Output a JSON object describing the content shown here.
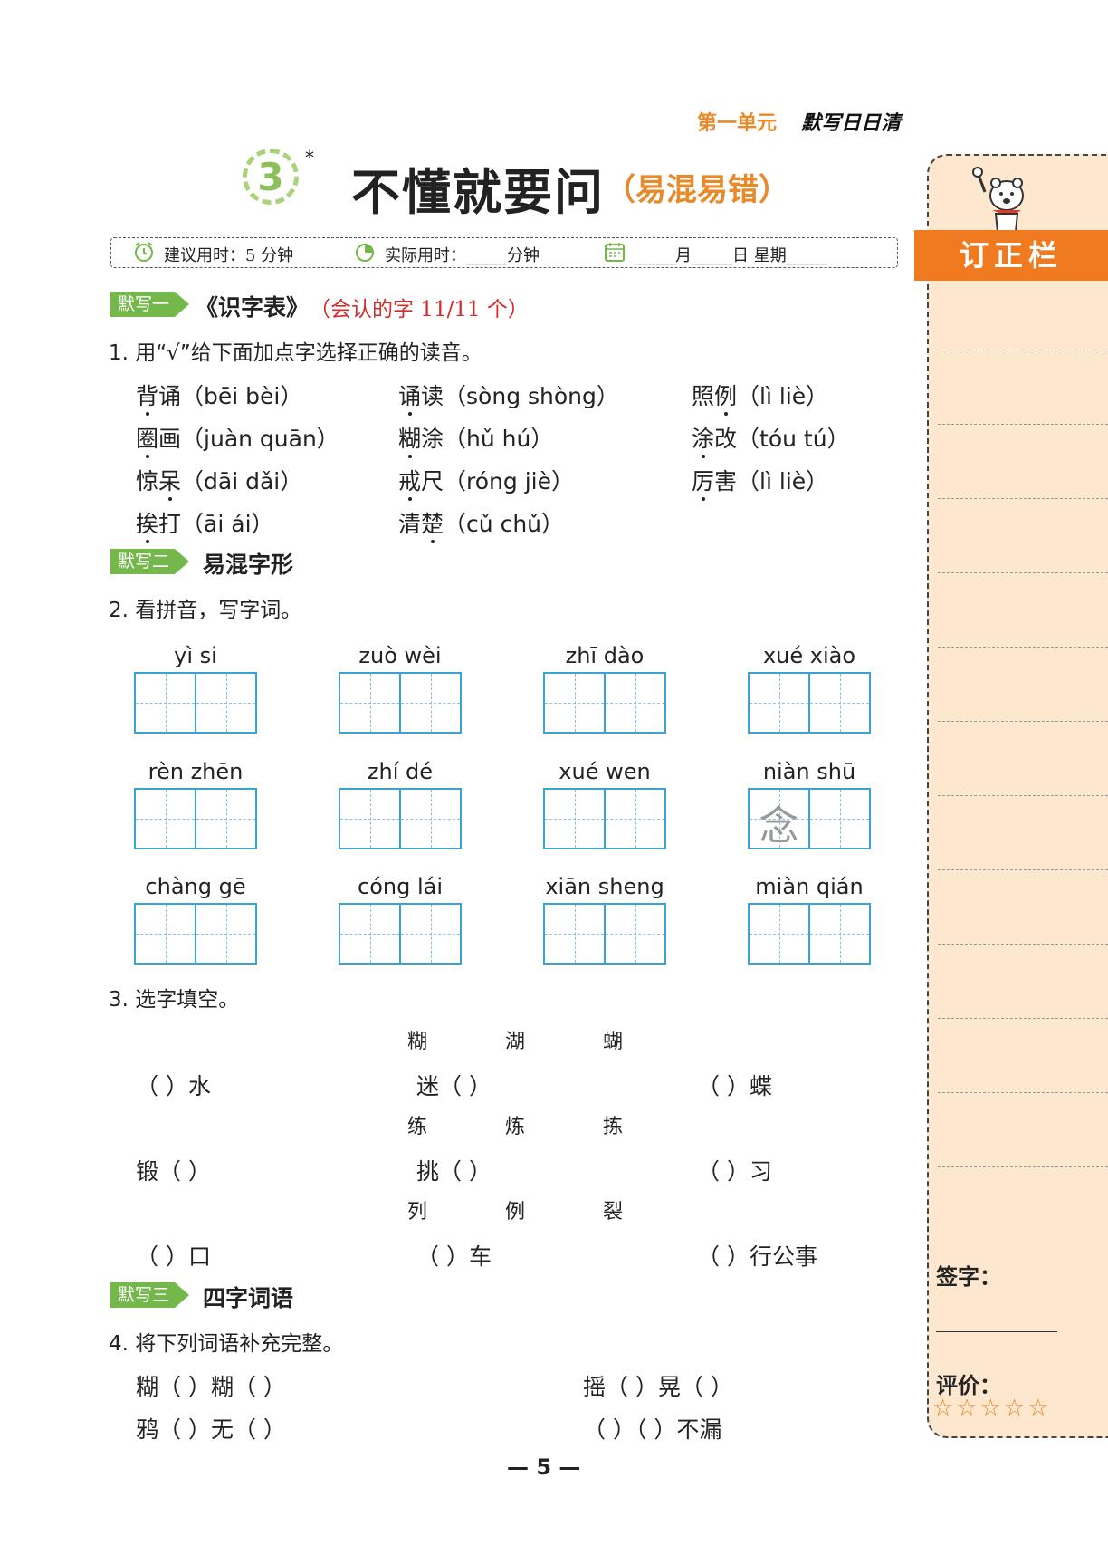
{
  "header": {
    "unit": "第一单元",
    "sub": "默写日日清"
  },
  "lesson": {
    "number": "3",
    "star": "*",
    "title": "不懂就要问",
    "subtitle": "（易混易错）"
  },
  "timebar": {
    "suggest": "建议用时：5 分钟",
    "actual": "实际用时：_____分钟",
    "date": "_____月_____日   星期_____"
  },
  "section1": {
    "tag": "默写一",
    "title": "《识字表》",
    "note": "（会认的字 11/11 个）"
  },
  "q1": {
    "title": "1. 用“√”给下面加点字选择正确的读音。",
    "items": [
      {
        "word": "背诵",
        "dot": 0,
        "pinyin": "（bēi    bèi）"
      },
      {
        "word": "诵读",
        "dot": 0,
        "pinyin": "（sòng    shòng）"
      },
      {
        "word": "照例",
        "dot": 1,
        "pinyin": "（lì    liè）"
      },
      {
        "word": "圈画",
        "dot": 0,
        "pinyin": "（juàn    quān）"
      },
      {
        "word": "糊涂",
        "dot": 0,
        "pinyin": "（hǔ    hú）"
      },
      {
        "word": "涂改",
        "dot": 0,
        "pinyin": "（tóu    tú）"
      },
      {
        "word": "惊呆",
        "dot": 1,
        "pinyin": "（dāi    dǎi）"
      },
      {
        "word": "戒尺",
        "dot": 0,
        "pinyin": "（róng    jiè）"
      },
      {
        "word": "厉害",
        "dot": 0,
        "pinyin": "（lì    liè）"
      },
      {
        "word": "挨打",
        "dot": 0,
        "pinyin": "（āi    ái）"
      },
      {
        "word": "清楚",
        "dot": 1,
        "pinyin": "（cǔ    chǔ）"
      }
    ]
  },
  "section2": {
    "tag": "默写二",
    "title": "易混字形"
  },
  "q2": {
    "title": "2. 看拼音，写字词。",
    "items": [
      {
        "pinyin": "yì    si",
        "hint": ""
      },
      {
        "pinyin": "zuò    wèi",
        "hint": ""
      },
      {
        "pinyin": "zhī    dào",
        "hint": ""
      },
      {
        "pinyin": "xué    xiào",
        "hint": ""
      },
      {
        "pinyin": "rèn    zhēn",
        "hint": ""
      },
      {
        "pinyin": "zhí    dé",
        "hint": ""
      },
      {
        "pinyin": "xué    wen",
        "hint": ""
      },
      {
        "pinyin": "niàn    shū",
        "hint": "念"
      },
      {
        "pinyin": "chàng  gē",
        "hint": ""
      },
      {
        "pinyin": "cóng    lái",
        "hint": ""
      },
      {
        "pinyin": "xiān sheng",
        "hint": ""
      },
      {
        "pinyin": "miàn  qián",
        "hint": ""
      }
    ]
  },
  "q3": {
    "title": "3. 选字填空。",
    "groups": [
      {
        "options": [
          "糊",
          "湖",
          "蝴"
        ],
        "blanks": [
          "（          ）水",
          "迷（          ）",
          "（          ）蝶"
        ]
      },
      {
        "options": [
          "练",
          "炼",
          "拣"
        ],
        "blanks": [
          "锻（          ）",
          "挑（          ）",
          "（          ）习"
        ]
      },
      {
        "options": [
          "列",
          "例",
          "裂"
        ],
        "blanks": [
          "（          ）口",
          "（          ）车",
          "（          ）行公事"
        ]
      }
    ]
  },
  "section3": {
    "tag": "默写三",
    "title": "四字词语"
  },
  "q4": {
    "title": "4. 将下列词语补充完整。",
    "items": [
      "糊（          ）糊（          ）",
      "摇（          ）晃（          ）",
      "鸦（          ）无（          ）",
      "（          ）（          ）不漏"
    ]
  },
  "side": {
    "banner": "订正栏",
    "sign": "签字：",
    "eval": "评价：",
    "stars": "☆☆☆☆☆"
  },
  "page_number": "— 5 —"
}
